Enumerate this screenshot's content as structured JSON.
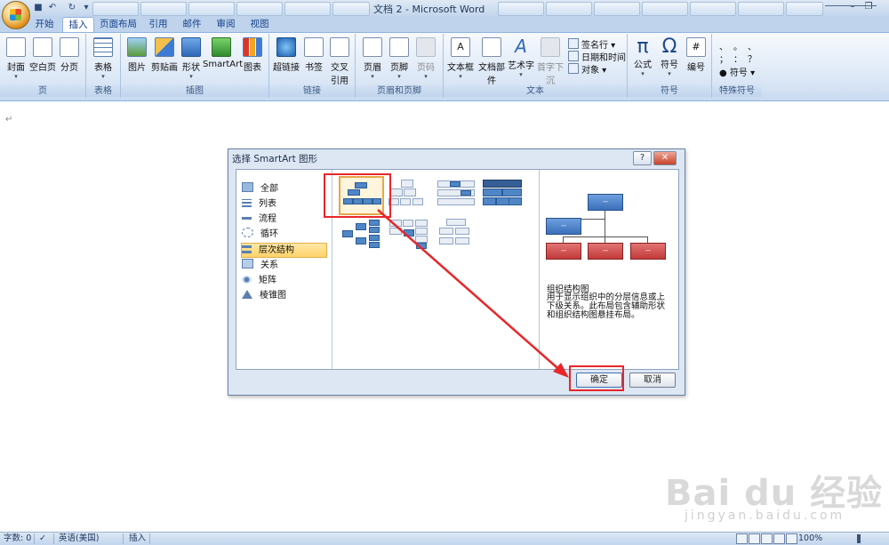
{
  "window": {
    "title": "文档 2 - Microsoft Word"
  },
  "tabs": [
    "开始",
    "插入",
    "页面布局",
    "引用",
    "邮件",
    "审阅",
    "视图"
  ],
  "ribbon": {
    "page": {
      "label": "页",
      "items": [
        "封面",
        "空白页",
        "分页"
      ]
    },
    "table": {
      "label": "表格",
      "items": [
        "表格"
      ]
    },
    "illus": {
      "label": "插图",
      "items": [
        "图片",
        "剪贴画",
        "形状",
        "SmartArt",
        "图表"
      ]
    },
    "links": {
      "label": "链接",
      "items": [
        "超链接",
        "书签",
        "交叉",
        "引用"
      ]
    },
    "hf": {
      "label": "页眉和页脚",
      "items": [
        "页眉",
        "页脚",
        "页码"
      ]
    },
    "text": {
      "label": "文本",
      "items": [
        "文本框",
        "文档部件",
        "艺术字",
        "首字下沉"
      ],
      "small": [
        "签名行",
        "日期和时间",
        "对象"
      ]
    },
    "symbols": {
      "label": "符号",
      "items": [
        "公式",
        "符号",
        "编号"
      ],
      "glyphs": [
        "π",
        "Ω",
        "#"
      ]
    },
    "special": {
      "label": "特殊符号",
      "glyphs": [
        "、",
        "。",
        "、",
        "；",
        "：",
        "？"
      ],
      "symbol_btn": "符号"
    }
  },
  "dialog": {
    "title": "选择 SmartArt 图形",
    "help": "?",
    "close": "✕",
    "categories": [
      "全部",
      "列表",
      "流程",
      "循环",
      "层次结构",
      "关系",
      "矩阵",
      "棱锥图"
    ],
    "preview": {
      "title": "组织结构图",
      "desc": "用于显示组织中的分层信息或上下级关系。此布局包含辅助形状和组织结构图悬挂布局。",
      "box_text": "--"
    },
    "ok": "确定",
    "cancel": "取消"
  },
  "status": {
    "words": "字数: 0",
    "lang": "英语(美国)",
    "mode": "插入",
    "zoom": "100%"
  },
  "watermark": {
    "logo": "Bai du 经验",
    "url": "jingyan.baidu.com"
  }
}
